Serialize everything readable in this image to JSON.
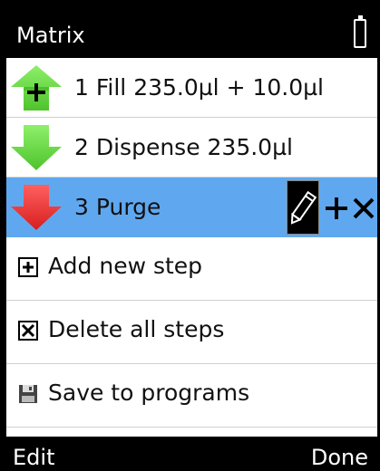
{
  "title": "Matrix",
  "battery_icon": "battery-icon",
  "steps": [
    {
      "label": "1  Fill 235.0µl + 10.0µl",
      "icon": "up-arrow-add-icon",
      "color": "#6fe04a"
    },
    {
      "label": "2  Dispense 235.0µl",
      "icon": "down-arrow-icon",
      "color": "#6fe04a"
    },
    {
      "label": "3  Purge",
      "icon": "down-arrow-icon",
      "color": "#f03a3a",
      "selected": true
    }
  ],
  "step_tools": [
    "pencil-icon",
    "plus-icon",
    "close-icon"
  ],
  "actions": [
    {
      "label": "Add new step",
      "icon": "plus-box-icon"
    },
    {
      "label": "Delete all steps",
      "icon": "x-box-icon"
    },
    {
      "label": "Save to programs",
      "icon": "save-icon"
    }
  ],
  "softkeys": {
    "left": "Edit",
    "right": "Done"
  },
  "colors": {
    "selected_row": "#5fa8ef",
    "bar": "#000000"
  }
}
